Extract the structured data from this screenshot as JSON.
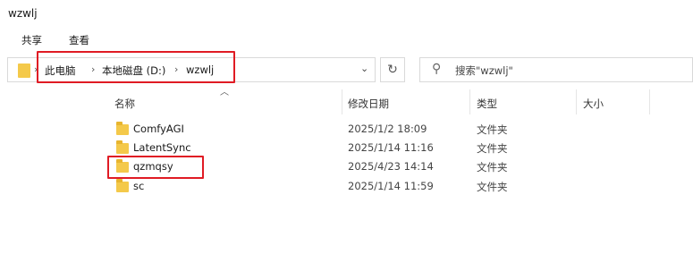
{
  "window": {
    "title": "wzwlj"
  },
  "ribbon": {
    "share": "共享",
    "view": "查看"
  },
  "address": {
    "crumbs": [
      "此电脑",
      "本地磁盘 (D:)",
      "wzwlj"
    ],
    "separator": "›",
    "dropdown": "⌄"
  },
  "search": {
    "placeholder": "搜索\"wzwlj\""
  },
  "columns": {
    "name": "名称",
    "date": "修改日期",
    "type": "类型",
    "size": "大小"
  },
  "files": [
    {
      "name": "ComfyAGI",
      "date": "2025/1/2 18:09",
      "type": "文件夹"
    },
    {
      "name": "LatentSync",
      "date": "2025/1/14 11:16",
      "type": "文件夹"
    },
    {
      "name": "qzmqsy",
      "date": "2025/4/23 14:14",
      "type": "文件夹"
    },
    {
      "name": "sc",
      "date": "2025/1/14 11:59",
      "type": "文件夹"
    }
  ],
  "colors": {
    "highlight": "#e01b24",
    "folder": "#f4c94a"
  }
}
